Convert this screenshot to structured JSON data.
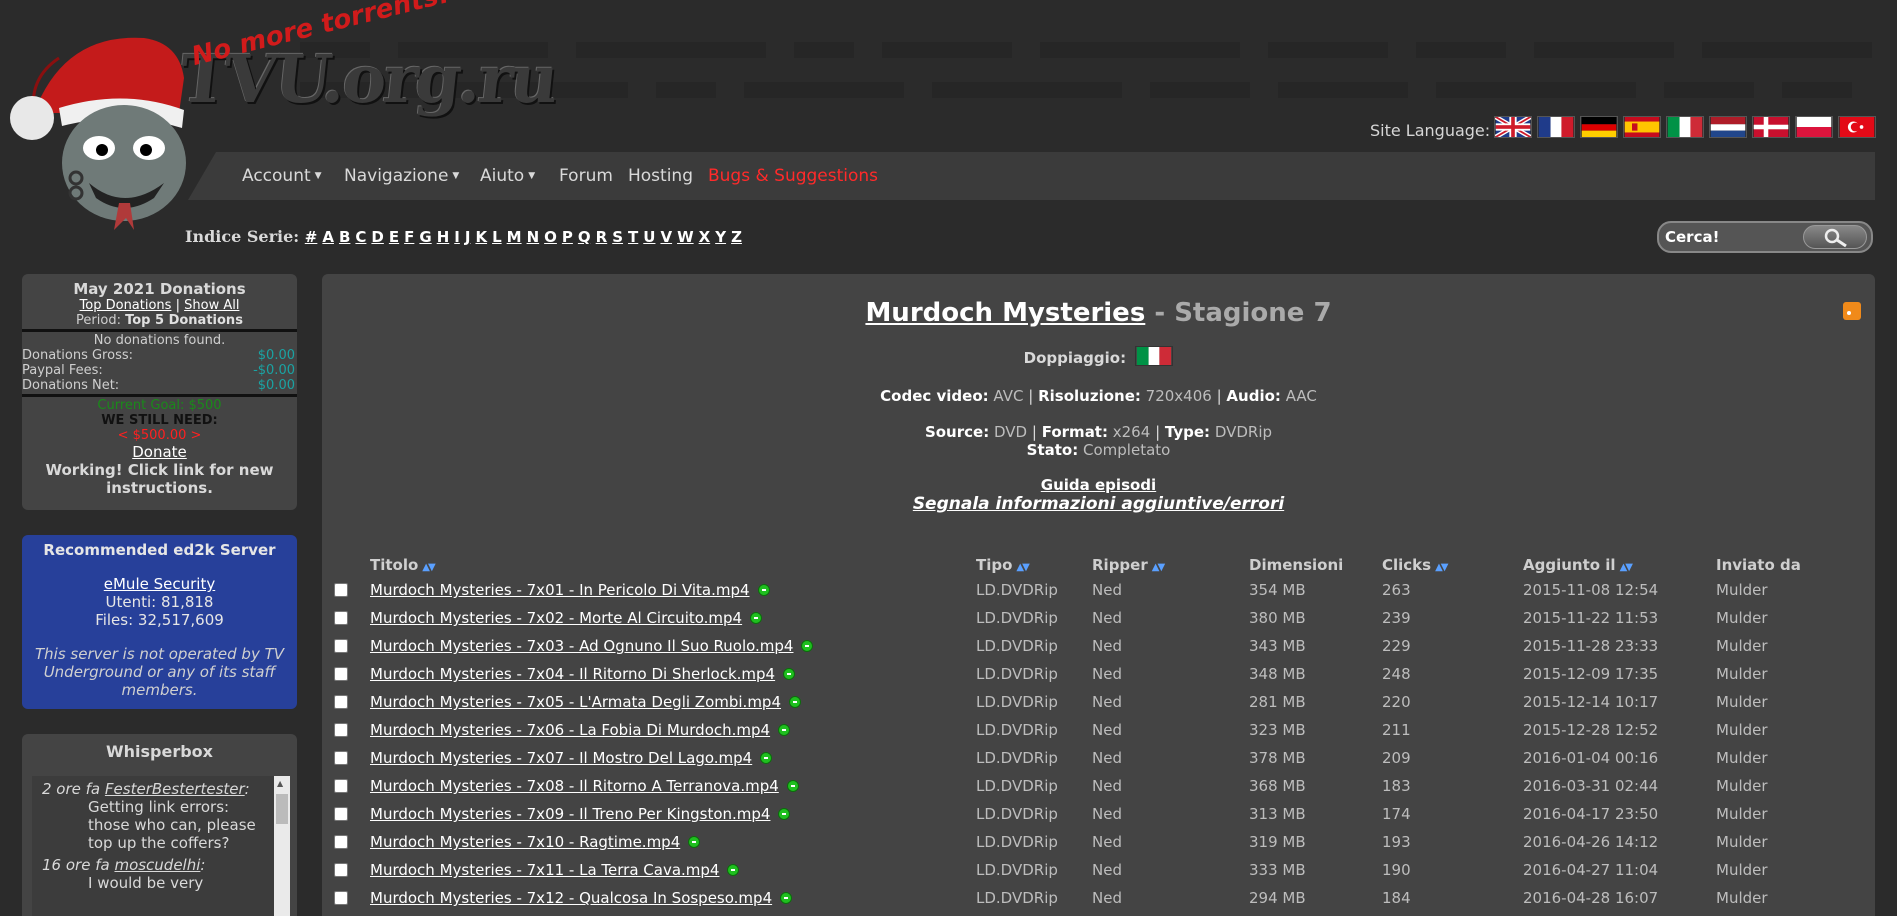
{
  "header": {
    "site_name": "TVU.org.ru",
    "tagline": "No more torrents!",
    "language_label": "Site Language:",
    "flags": [
      {
        "lang": "English",
        "colors": [
          "#1f3b8a",
          "#ffffff",
          "#cf1b2b"
        ]
      },
      {
        "lang": "French",
        "colors": [
          "#1f3b8a",
          "#ffffff",
          "#cf1b2b"
        ]
      },
      {
        "lang": "German",
        "colors": [
          "#000000",
          "#dd0000",
          "#ffce00"
        ]
      },
      {
        "lang": "Spanish",
        "colors": [
          "#c60b1e",
          "#ffc400",
          "#c60b1e"
        ]
      },
      {
        "lang": "Italian",
        "colors": [
          "#009246",
          "#ffffff",
          "#ce2b37"
        ]
      },
      {
        "lang": "Dutch",
        "colors": [
          "#ae1c28",
          "#ffffff",
          "#21468b"
        ]
      },
      {
        "lang": "Danish",
        "colors": [
          "#c8102e",
          "#ffffff",
          "#c8102e"
        ]
      },
      {
        "lang": "Polish",
        "colors": [
          "#ffffff",
          "#ffffff",
          "#dc143c"
        ]
      },
      {
        "lang": "Turkish",
        "colors": [
          "#e30a17",
          "#e30a17",
          "#e30a17"
        ]
      }
    ]
  },
  "nav": {
    "account": "Account",
    "navigazione": "Navigazione",
    "aiuto": "Aiuto",
    "forum": "Forum",
    "hosting": "Hosting",
    "bugs": "Bugs & Suggestions"
  },
  "index": {
    "label": "Indice Serie:",
    "letters": [
      "#",
      "A",
      "B",
      "C",
      "D",
      "E",
      "F",
      "G",
      "H",
      "I",
      "J",
      "K",
      "L",
      "M",
      "N",
      "O",
      "P",
      "Q",
      "R",
      "S",
      "T",
      "U",
      "V",
      "W",
      "X",
      "Y",
      "Z"
    ]
  },
  "search": {
    "placeholder": "Cerca!"
  },
  "donations": {
    "title": "May 2021 Donations",
    "top_link": "Top Donations",
    "separator": "|",
    "show_all": "Show All",
    "period_label": "Period:",
    "period_value": "Top 5 Donations",
    "none": "No donations found.",
    "gross_label": "Donations Gross:",
    "gross_value": "$0.00",
    "fees_label": "Paypal Fees:",
    "fees_value": "-$0.00",
    "net_label": "Donations Net:",
    "net_value": "$0.00",
    "goal": "Current Goal: $500",
    "need_label": "WE STILL NEED:",
    "need_value": "< $500.00 >",
    "donate": "Donate",
    "note": "Working! Click link for new instructions."
  },
  "server": {
    "title": "Recommended ed2k Server",
    "name": "eMule Security",
    "users": "Utenti: 81,818",
    "files": "Files: 32,517,609",
    "note": "This server is not operated by TV Underground or any of its staff members."
  },
  "whisperbox": {
    "title": "Whisperbox",
    "messages": [
      {
        "time": "2 ore fa",
        "user": "FesterBestertester",
        "sep": ":",
        "text": "Getting link errors: those who can, please top up the coffers?"
      },
      {
        "time": "16 ore fa",
        "user": "moscudelhi",
        "sep": ":",
        "text": "I would be very"
      }
    ]
  },
  "main": {
    "show": "Murdoch Mysteries",
    "season": " - Stagione 7",
    "dub_label": "Doppiaggio:",
    "codec_label": "Codec video:",
    "codec_value": "AVC",
    "res_label": "Risoluzione:",
    "res_value": "720x406",
    "audio_label": "Audio:",
    "audio_value": "AAC",
    "source_label": "Source:",
    "source_value": "DVD",
    "format_label": "Format:",
    "format_value": "x264",
    "type_label": "Type:",
    "type_value": "DVDRip",
    "status_label": "Stato:",
    "status_value": "Completato",
    "pipe": "|",
    "guide": "Guida episodi",
    "report": "Segnala informazioni aggiuntive/errori",
    "columns": {
      "title": "Titolo",
      "tipo": "Tipo",
      "ripper": "Ripper",
      "size": "Dimensioni",
      "clicks": "Clicks",
      "added": "Aggiunto il",
      "by": "Inviato da"
    },
    "episodes": [
      {
        "title": "Murdoch Mysteries - 7x01 - In Pericolo Di Vita.mp4",
        "tipo": "LD.DVDRip",
        "ripper": "Ned",
        "size": "354 MB",
        "clicks": "263",
        "added": "2015-11-08 12:54",
        "by": "Mulder"
      },
      {
        "title": "Murdoch Mysteries - 7x02 - Morte Al Circuito.mp4",
        "tipo": "LD.DVDRip",
        "ripper": "Ned",
        "size": "380 MB",
        "clicks": "239",
        "added": "2015-11-22 11:53",
        "by": "Mulder"
      },
      {
        "title": "Murdoch Mysteries - 7x03 - Ad Ognuno Il Suo Ruolo.mp4",
        "tipo": "LD.DVDRip",
        "ripper": "Ned",
        "size": "343 MB",
        "clicks": "229",
        "added": "2015-11-28 23:33",
        "by": "Mulder"
      },
      {
        "title": "Murdoch Mysteries - 7x04 - Il Ritorno Di Sherlock.mp4",
        "tipo": "LD.DVDRip",
        "ripper": "Ned",
        "size": "348 MB",
        "clicks": "248",
        "added": "2015-12-09 17:35",
        "by": "Mulder"
      },
      {
        "title": "Murdoch Mysteries - 7x05 - L'Armata Degli Zombi.mp4",
        "tipo": "LD.DVDRip",
        "ripper": "Ned",
        "size": "281 MB",
        "clicks": "220",
        "added": "2015-12-14 10:17",
        "by": "Mulder"
      },
      {
        "title": "Murdoch Mysteries - 7x06 - La Fobia Di Murdoch.mp4",
        "tipo": "LD.DVDRip",
        "ripper": "Ned",
        "size": "323 MB",
        "clicks": "211",
        "added": "2015-12-28 12:52",
        "by": "Mulder"
      },
      {
        "title": "Murdoch Mysteries - 7x07 - Il Mostro Del Lago.mp4",
        "tipo": "LD.DVDRip",
        "ripper": "Ned",
        "size": "378 MB",
        "clicks": "209",
        "added": "2016-01-04 00:16",
        "by": "Mulder"
      },
      {
        "title": "Murdoch Mysteries - 7x08 - Il Ritorno A Terranova.mp4",
        "tipo": "LD.DVDRip",
        "ripper": "Ned",
        "size": "368 MB",
        "clicks": "183",
        "added": "2016-03-31 02:44",
        "by": "Mulder"
      },
      {
        "title": "Murdoch Mysteries - 7x09 - Il Treno Per Kingston.mp4",
        "tipo": "LD.DVDRip",
        "ripper": "Ned",
        "size": "313 MB",
        "clicks": "174",
        "added": "2016-04-17 23:50",
        "by": "Mulder"
      },
      {
        "title": "Murdoch Mysteries - 7x10 - Ragtime.mp4",
        "tipo": "LD.DVDRip",
        "ripper": "Ned",
        "size": "319 MB",
        "clicks": "193",
        "added": "2016-04-26 14:12",
        "by": "Mulder"
      },
      {
        "title": "Murdoch Mysteries - 7x11 - La Terra Cava.mp4",
        "tipo": "LD.DVDRip",
        "ripper": "Ned",
        "size": "333 MB",
        "clicks": "190",
        "added": "2016-04-27 11:04",
        "by": "Mulder"
      },
      {
        "title": "Murdoch Mysteries - 7x12 - Qualcosa In Sospeso.mp4",
        "tipo": "LD.DVDRip",
        "ripper": "Ned",
        "size": "294 MB",
        "clicks": "184",
        "added": "2016-04-28 16:07",
        "by": "Mulder"
      }
    ]
  },
  "colors": {
    "background": "#2b2b2b",
    "panel": "#444444",
    "server_panel": "#27409a",
    "accent_red": "#ff2a2a",
    "ed2k_green": "#1fbf1f"
  }
}
